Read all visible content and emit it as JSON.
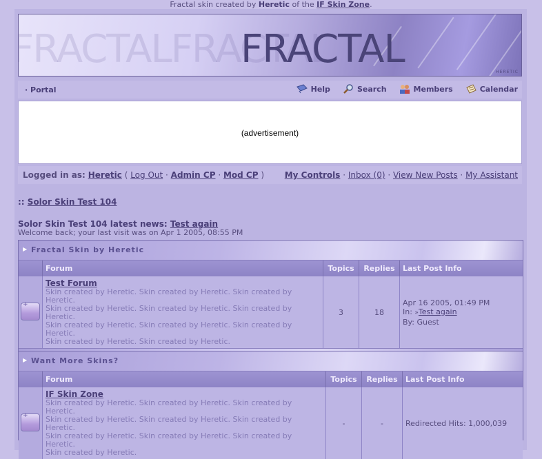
{
  "credit": {
    "prefix": "Fractal skin created by",
    "author": "Heretic",
    "middle": "of the",
    "site": "IF Skin Zone",
    "suffix": "."
  },
  "banner": {
    "logo_text": "FRACTAL",
    "ghost_text": "FRACTALFRACTAL",
    "signature": "HERETIC"
  },
  "nav": {
    "portal": "Portal",
    "items": [
      {
        "label": "Help",
        "icon": "help-icon"
      },
      {
        "label": "Search",
        "icon": "search-icon"
      },
      {
        "label": "Members",
        "icon": "members-icon"
      },
      {
        "label": "Calendar",
        "icon": "calendar-icon"
      }
    ]
  },
  "ad": {
    "text": "(advertisement)"
  },
  "userbar": {
    "logged_in_label": "Logged in as:",
    "username": "Heretic",
    "logout": "Log Out",
    "admin_cp": "Admin CP",
    "mod_cp": "Mod CP",
    "my_controls": "My Controls",
    "inbox": "Inbox (0)",
    "view_new_posts": "View New Posts",
    "my_assistant": "My Assistant"
  },
  "breadcrumb": {
    "prefix": "::",
    "board": "Solor Skin Test 104"
  },
  "news": {
    "label": "Solor Skin Test 104 latest news:",
    "link": "Test again"
  },
  "welcome": "Welcome back; your last visit was on Apr 1 2005, 08:55 PM",
  "categories": [
    {
      "title": "Fractal Skin by Heretic",
      "columns": [
        "Forum",
        "Topics",
        "Replies",
        "Last Post Info"
      ],
      "forum": {
        "name": "Test Forum",
        "description": [
          "Skin created by Heretic. Skin created by Heretic. Skin created by Heretic.",
          "Skin created by Heretic. Skin created by Heretic. Skin created by Heretic.",
          "Skin created by Heretic. Skin created by Heretic. Skin created by Heretic.",
          "Skin created by Heretic. Skin created by Heretic."
        ],
        "topics": "3",
        "replies": "18",
        "last_post_date": "Apr 16 2005, 01:49 PM",
        "last_post_in_label": "In:",
        "last_post_topic": "Test again",
        "last_post_by": "By: Guest"
      }
    },
    {
      "title": "Want More Skins?",
      "columns": [
        "Forum",
        "Topics",
        "Replies",
        "Last Post Info"
      ],
      "forum": {
        "name": "IF Skin Zone",
        "description": [
          "Skin created by Heretic. Skin created by Heretic. Skin created by Heretic.",
          "Skin created by Heretic. Skin created by Heretic. Skin created by Heretic.",
          "Skin created by Heretic. Skin created by Heretic. Skin created by Heretic.",
          "Skin created by Heretic."
        ],
        "topics": "-",
        "replies": "-",
        "last_post_info": "Redirected Hits: 1,000,039"
      }
    }
  ],
  "colors": {
    "page_bg": "#c8c0e8",
    "link": "#4a3f78",
    "text": "#574d7e",
    "header_cell": "#9d93d2"
  }
}
